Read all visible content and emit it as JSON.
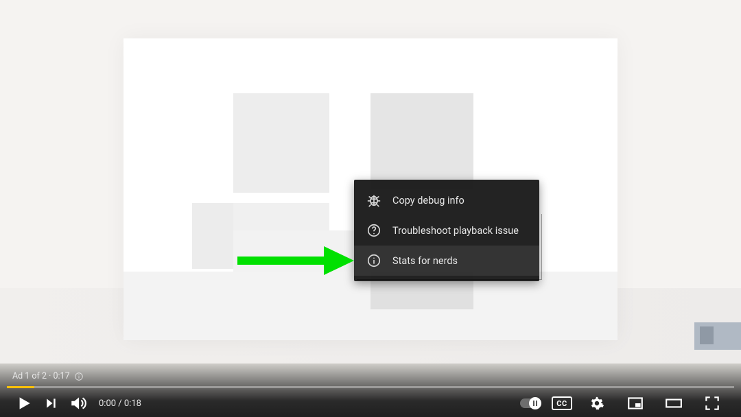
{
  "context_menu": {
    "items": [
      {
        "icon": "bug-icon",
        "label": "Copy debug info"
      },
      {
        "icon": "help-icon",
        "label": "Troubleshoot playback issue"
      },
      {
        "icon": "info-icon",
        "label": "Stats for nerds"
      }
    ],
    "highlighted_index": 2
  },
  "annotation": {
    "arrow_color": "#00e000",
    "points_to": "Stats for nerds"
  },
  "player": {
    "ad_text": "Ad 1 of 2 · 0:17",
    "current_time": "0:00",
    "duration": "0:18",
    "time_display": "0:00 / 0:18",
    "cc_label": "CC",
    "progress_bar_color": "#ffc107",
    "controls": {
      "play": "play-icon",
      "next": "next-icon",
      "volume": "volume-icon",
      "autoplay": "autoplay-toggle",
      "subtitles": "cc-button",
      "settings": "gear-icon",
      "miniplayer": "miniplayer-icon",
      "theater": "theater-icon",
      "fullscreen": "fullscreen-icon"
    }
  }
}
